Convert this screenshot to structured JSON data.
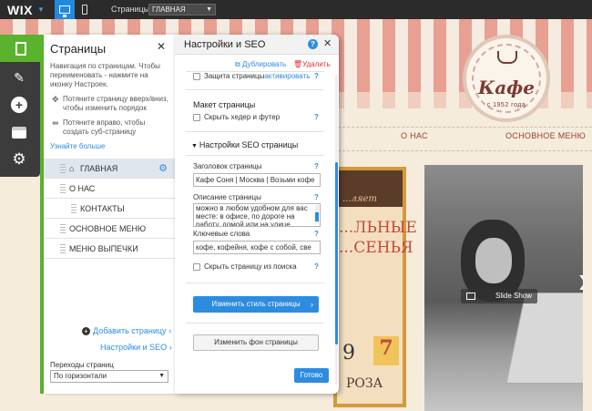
{
  "topbar": {
    "logo": "WIX",
    "pages_label": "Страницы:",
    "current_page": "ГЛАВНАЯ"
  },
  "site": {
    "logo_title": "Кафе",
    "logo_sub": "с 1952 года",
    "nav": [
      "О НАС",
      "ОСНОВНОЕ МЕНЮ"
    ],
    "poster_script": "...ляет",
    "poster_big_1": "...ЛЬНЫЕ",
    "poster_big_2": "...СЕНЬЯ",
    "poster_num": "9",
    "poster_seven": "7",
    "poster_word": "РОЗА",
    "slideshow_label": "Slide Show"
  },
  "pages_panel": {
    "title": "Страницы",
    "description": "Навигация по страницам. Чтобы переименовать - нажмите на иконку Настроек.",
    "tip1": "Потяните страницу вверх/вниз, чтобы изменить порядок",
    "tip2": "Потяните вправо, чтобы создать суб-страницу",
    "learn_more": "Узнайте больше",
    "pages": [
      {
        "label": "ГЛАВНАЯ"
      },
      {
        "label": "О НАС"
      },
      {
        "label": "КОНТАКТЫ"
      },
      {
        "label": "ОСНОВНОЕ МЕНЮ"
      },
      {
        "label": "МЕНЮ ВЫПЕЧКИ"
      }
    ],
    "add_page": "Добавить страницу",
    "seo_settings": "Настройки и SEO",
    "transitions_label": "Переходы страниц",
    "transitions_value": "По горизонтали"
  },
  "seo_panel": {
    "title": "Настройки и SEO",
    "duplicate": "Дублировать",
    "delete": "Удалить",
    "protect_label": "Защита страницы",
    "protect_link": "активировать",
    "layout_title": "Макет страницы",
    "hide_header_footer": "Скрыть хедер и футер",
    "seo_section_title": "Настройки SEO страницы",
    "page_title_label": "Заголовок страницы",
    "page_title_value": "Кафе Соня | Москва | Возьми кофе",
    "description_label": "Описание страницы",
    "description_value": "можно в любом удобном для вас месте: в офисе, по дороге на работу, домой или на улице.",
    "keywords_label": "Ключевые слова",
    "keywords_value": "кофе, кофейня, кофе с собой, све",
    "hide_from_search": "Скрыть страницу из поиска",
    "change_style": "Изменить стиль страницы",
    "change_bg": "Изменить фон страницы",
    "done": "Готово"
  },
  "colors": {
    "accent": "#2d8ce0",
    "wix_green": "#5ab22d",
    "stripe_red": "#e8a092",
    "brand_brown": "#7b3a33"
  }
}
